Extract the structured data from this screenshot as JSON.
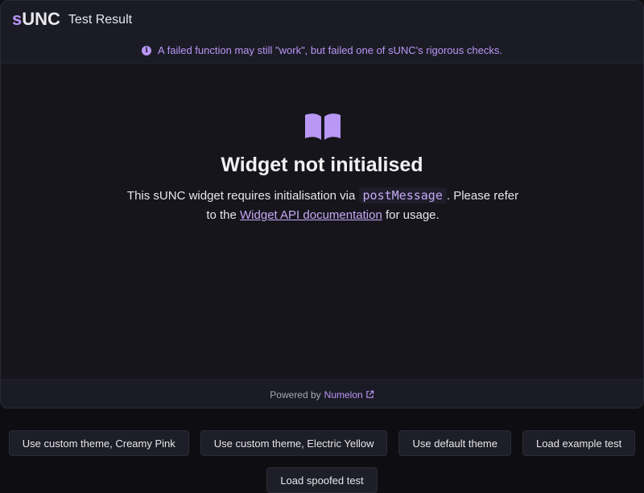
{
  "header": {
    "brand_s": "s",
    "brand_unc": "UNC",
    "title": "Test Result"
  },
  "notice": {
    "icon": "info-icon",
    "text": "A failed function may still \"work\", but failed one of sUNC's rigorous checks."
  },
  "main": {
    "icon": "book-open-icon",
    "title": "Widget not initialised",
    "desc_before": "This sUNC widget requires initialisation via ",
    "code": "postMessage",
    "desc_middle": ". Please refer to the ",
    "link_text": "Widget API documentation",
    "desc_after": " for usage."
  },
  "footer": {
    "powered_by": "Powered by",
    "link_text": "Numelon",
    "icon": "external-link-icon"
  },
  "buttons": [
    "Use custom theme, Creamy Pink",
    "Use custom theme, Electric Yellow",
    "Use default theme",
    "Load example test",
    "Load spoofed test"
  ],
  "colors": {
    "accent": "#b897f5",
    "background": "#0d0d12",
    "panel": "#16161f"
  }
}
